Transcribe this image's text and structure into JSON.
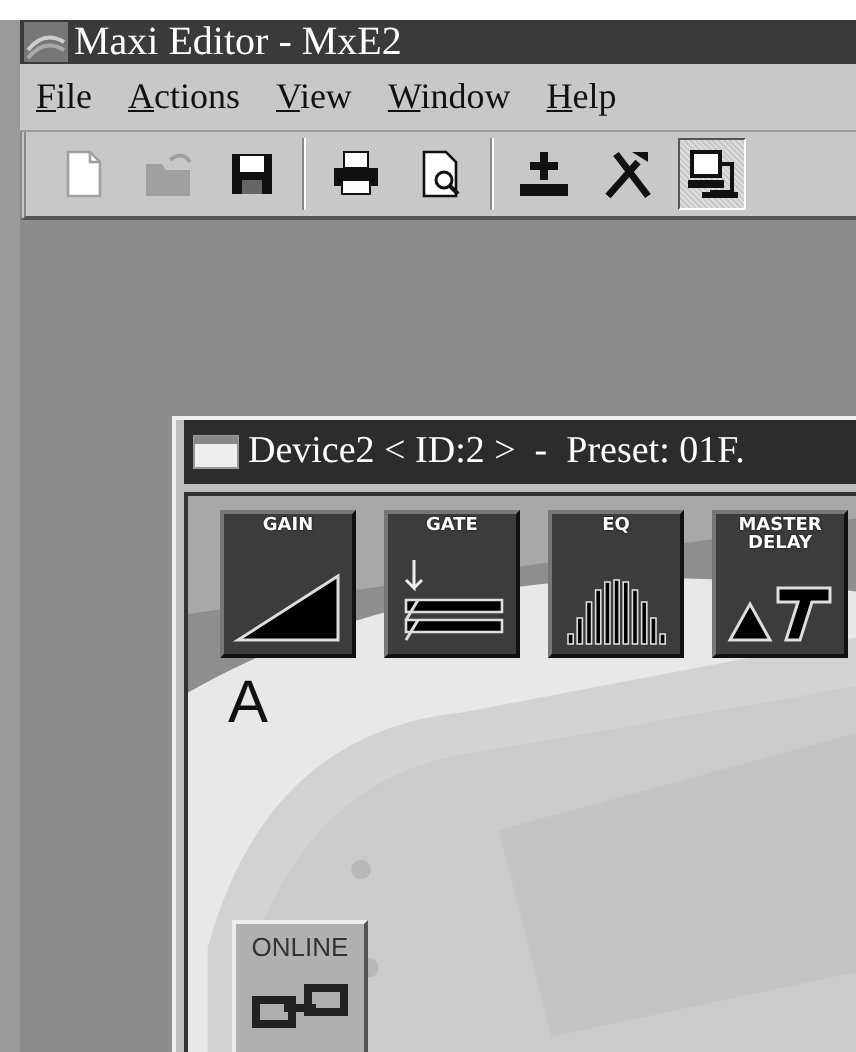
{
  "window": {
    "title": "Maxi Editor - MxE2"
  },
  "menu": [
    {
      "label": "File"
    },
    {
      "label": "Actions"
    },
    {
      "label": "View"
    },
    {
      "label": "Window"
    },
    {
      "label": "Help"
    }
  ],
  "toolbar": [
    {
      "kind": "new",
      "disabled": true,
      "pressed": false
    },
    {
      "kind": "open",
      "disabled": true,
      "pressed": false
    },
    {
      "kind": "save",
      "disabled": false,
      "pressed": false
    },
    {
      "kind": "separator"
    },
    {
      "kind": "print",
      "disabled": false,
      "pressed": false
    },
    {
      "kind": "preview",
      "disabled": false,
      "pressed": false
    },
    {
      "kind": "separator"
    },
    {
      "kind": "add",
      "disabled": false,
      "pressed": false
    },
    {
      "kind": "tools",
      "disabled": false,
      "pressed": false
    },
    {
      "kind": "device",
      "disabled": false,
      "pressed": true
    }
  ],
  "child_window": {
    "title": "Device2 < ID:2 >  -  Preset: 01F.",
    "modules": [
      {
        "kind": "gain",
        "label": "GAIN"
      },
      {
        "kind": "gate",
        "label": "GATE"
      },
      {
        "kind": "eq",
        "label": "EQ"
      },
      {
        "kind": "delay",
        "label": "MASTER DELAY"
      }
    ],
    "channel": "A",
    "online_button": {
      "label": "ONLINE"
    }
  }
}
